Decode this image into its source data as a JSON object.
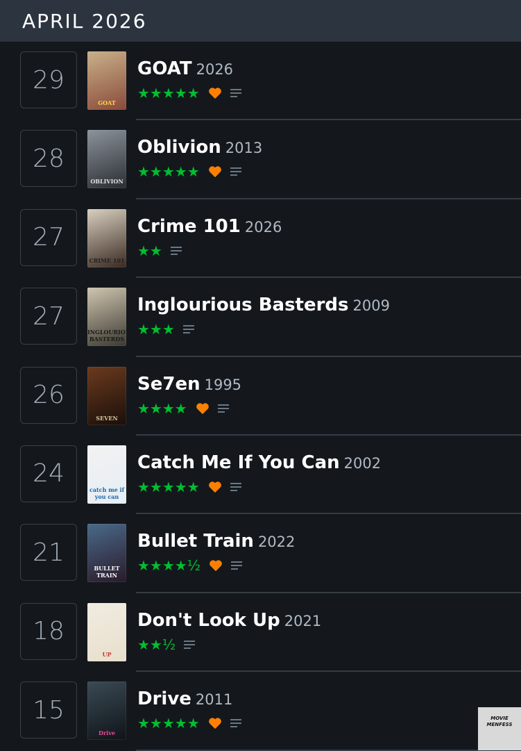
{
  "header": {
    "title": "APRIL 2026"
  },
  "entries": [
    {
      "day": "29",
      "title": "GOAT",
      "year": "2026",
      "stars": "★★★★★",
      "liked": true,
      "review": true,
      "poster_text": "GOAT",
      "poster_colors": [
        "#c9b18a",
        "#8a4a3a"
      ],
      "poster_text_color": "#ffd84a"
    },
    {
      "day": "28",
      "title": "Oblivion",
      "year": "2013",
      "stars": "★★★★★",
      "liked": true,
      "review": true,
      "poster_text": "OBLIVION",
      "poster_colors": [
        "#8c939a",
        "#2a2e33"
      ],
      "poster_text_color": "#e0e0e0"
    },
    {
      "day": "27",
      "title": "Crime 101",
      "year": "2026",
      "stars": "★★",
      "liked": false,
      "review": true,
      "poster_text": "CRIME 101",
      "poster_colors": [
        "#d8d0c0",
        "#3b2a22"
      ],
      "poster_text_color": "#222222"
    },
    {
      "day": "27",
      "title": "Inglourious Basterds",
      "year": "2009",
      "stars": "★★★",
      "liked": false,
      "review": true,
      "poster_text": "INGLOURIOUS BASTERDS",
      "poster_colors": [
        "#cfc6b0",
        "#3d3a32"
      ],
      "poster_text_color": "#1a1a1a"
    },
    {
      "day": "26",
      "title": "Se7en",
      "year": "1995",
      "stars": "★★★★",
      "liked": true,
      "review": true,
      "poster_text": "SEVEN",
      "poster_colors": [
        "#6b3a1e",
        "#1a0f0a"
      ],
      "poster_text_color": "#d8c8a0"
    },
    {
      "day": "24",
      "title": "Catch Me If You Can",
      "year": "2002",
      "stars": "★★★★★",
      "liked": true,
      "review": true,
      "poster_text": "catch me if you can",
      "poster_colors": [
        "#f2f2f2",
        "#e6eef5"
      ],
      "poster_text_color": "#1a66aa"
    },
    {
      "day": "21",
      "title": "Bullet Train",
      "year": "2022",
      "stars": "★★★★½",
      "liked": true,
      "review": true,
      "poster_text": "BULLET TRAIN",
      "poster_colors": [
        "#4a6a8a",
        "#2a1a2a"
      ],
      "poster_text_color": "#ffffff"
    },
    {
      "day": "18",
      "title": "Don't Look Up",
      "year": "2021",
      "stars": "★★½",
      "liked": false,
      "review": true,
      "poster_text": "UP",
      "poster_colors": [
        "#f1ece1",
        "#e8dfcc"
      ],
      "poster_text_color": "#c0392b"
    },
    {
      "day": "15",
      "title": "Drive",
      "year": "2011",
      "stars": "★★★★★",
      "liked": true,
      "review": true,
      "poster_text": "Drive",
      "poster_colors": [
        "#3a4a55",
        "#0f1418"
      ],
      "poster_text_color": "#e64a9a"
    }
  ],
  "watermark": {
    "line1": "MOVIE",
    "line2": "MENFESS"
  },
  "colors": {
    "star": "#00c030",
    "heart": "#ff8000",
    "review_icon": "#6b7885"
  }
}
